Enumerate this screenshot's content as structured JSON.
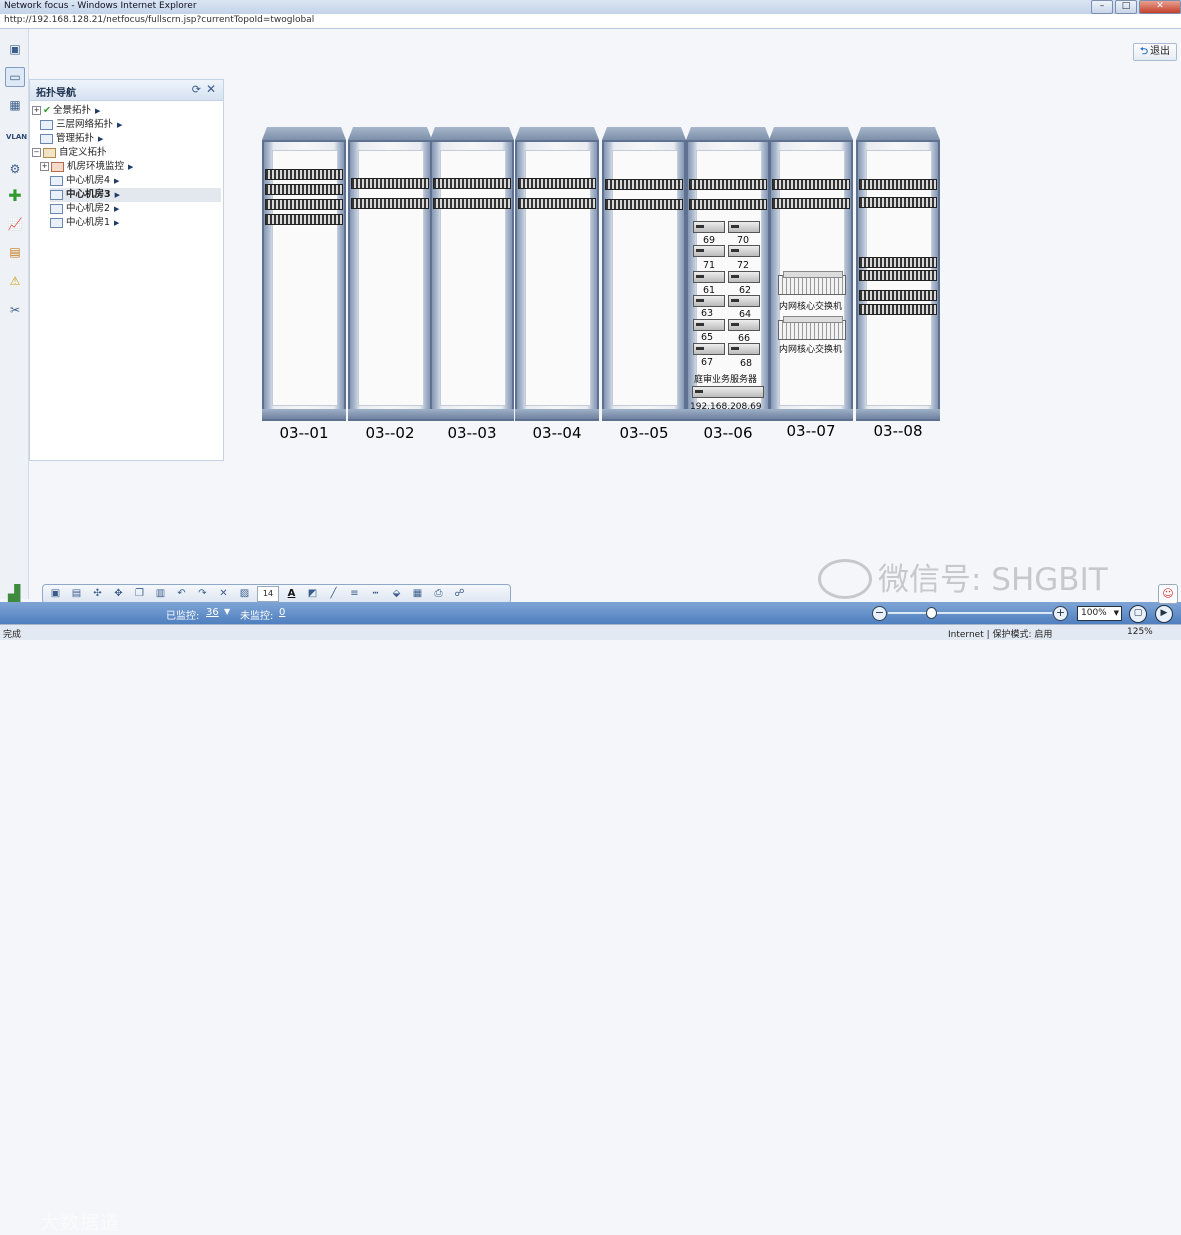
{
  "window": {
    "title": "Network focus - Windows Internet Explorer",
    "url": "http://192.168.128.21/netfocus/fullscrn.jsp?currentTopoId=twoglobal"
  },
  "left_toolbar": {
    "vlan_label": "VLAN"
  },
  "nav": {
    "title": "拓扑导航",
    "items": [
      {
        "label": "全景拓扑"
      },
      {
        "label": "三层网络拓扑"
      },
      {
        "label": "管理拓扑"
      },
      {
        "label": "自定义拓扑"
      },
      {
        "label": "机房环境监控"
      },
      {
        "label": "中心机房4"
      },
      {
        "label": "中心机房3"
      },
      {
        "label": "中心机房2"
      },
      {
        "label": "中心机房1"
      }
    ]
  },
  "logout_label": "退出",
  "racks": [
    {
      "label": "03--01"
    },
    {
      "label": "03--02"
    },
    {
      "label": "03--03"
    },
    {
      "label": "03--04"
    },
    {
      "label": "03--05"
    },
    {
      "label": "03--06"
    },
    {
      "label": "03--07"
    },
    {
      "label": "03--08"
    }
  ],
  "rack6": {
    "numbers": [
      "69",
      "70",
      "71",
      "72",
      "61",
      "62",
      "63",
      "64",
      "65",
      "66",
      "67",
      "68"
    ],
    "server_group_label": "庭审业务服务器",
    "ip": "192.168.208.69"
  },
  "rack7": {
    "switch_label_1": "内网核心交换机",
    "switch_label_2": "内网核心交换机"
  },
  "toolbar": {
    "font_size": "14"
  },
  "status": {
    "monitored_label": "已监控:",
    "monitored_value": "36",
    "unmonitored_label": "未监控:",
    "unmonitored_value": "0",
    "zoom_value": "100%"
  },
  "ie_status": {
    "done": "完成",
    "zone": "Internet | 保护模式: 启用",
    "zoom": "125%"
  },
  "watermark": {
    "text": "微信号: SHGBIT",
    "text2": "大数据道"
  }
}
